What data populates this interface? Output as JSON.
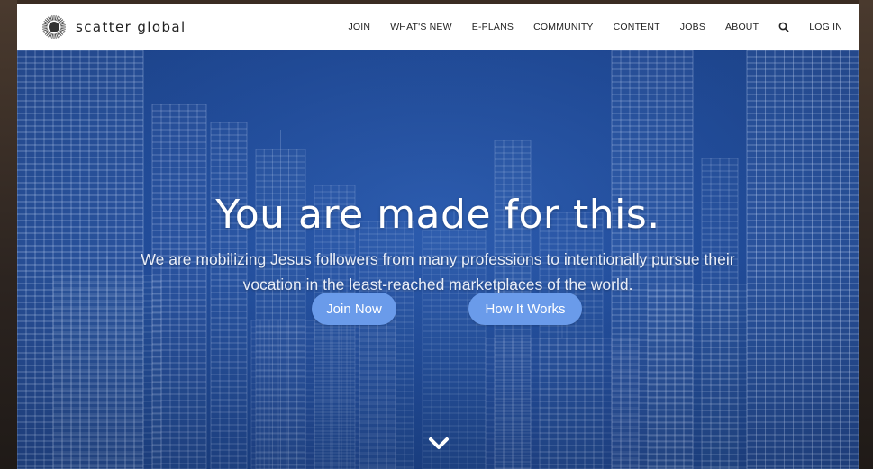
{
  "brand": {
    "name": "scatter global",
    "logo_icon": "sunburst-logo-icon"
  },
  "nav": {
    "items": [
      {
        "label": "JOIN"
      },
      {
        "label": "WHAT'S NEW"
      },
      {
        "label": "E-PLANS"
      },
      {
        "label": "COMMUNITY"
      },
      {
        "label": "CONTENT"
      },
      {
        "label": "JOBS"
      },
      {
        "label": "ABOUT"
      }
    ],
    "search_icon": "search-icon",
    "login": "LOG IN"
  },
  "hero": {
    "headline": "You are made for this.",
    "subtext": "We are mobilizing Jesus followers from many professions to intentionally pursue their vocation in the least-reached marketplaces of the world.",
    "buttons": {
      "join": "Join Now",
      "how": "How It Works"
    },
    "scroll_icon": "chevron-down-icon",
    "background": "blueprint-skyline"
  },
  "colors": {
    "hero_blue": "#234f9e",
    "button": "#6a9bea",
    "header_bg": "#ffffff",
    "text_dark": "#222222"
  }
}
